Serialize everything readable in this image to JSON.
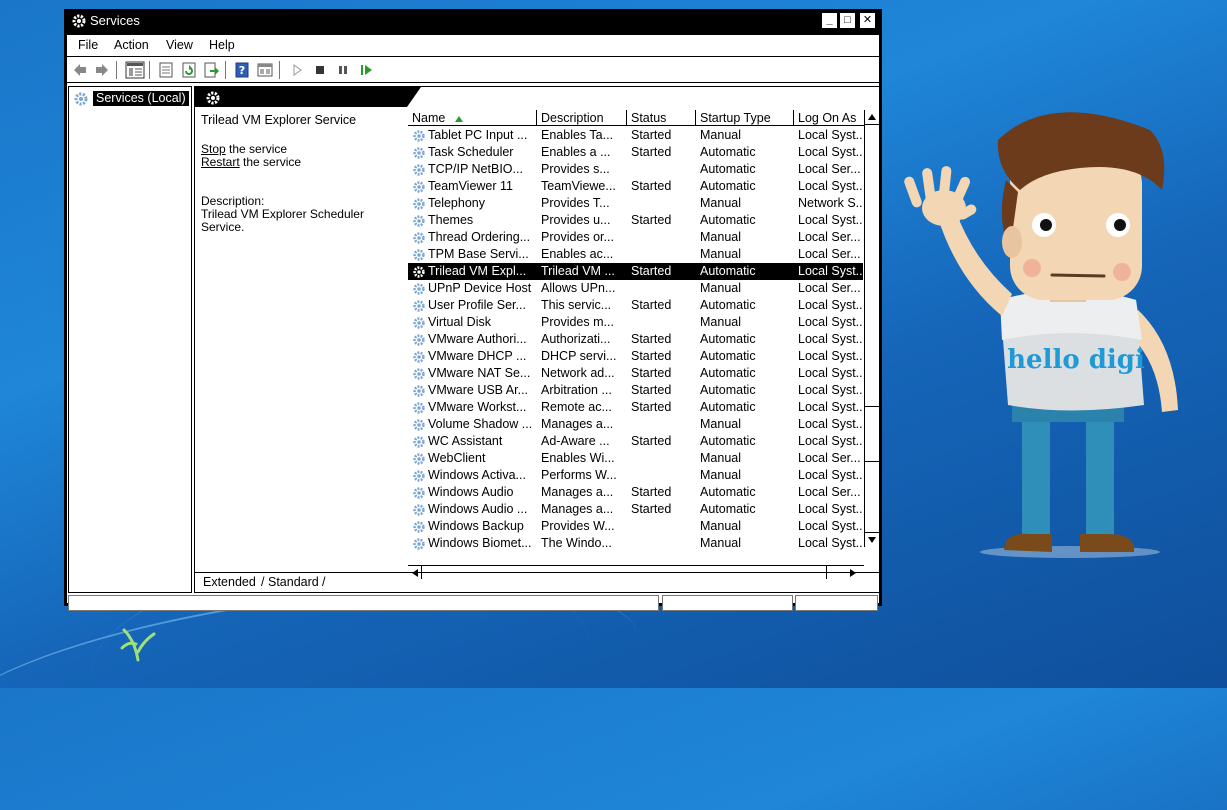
{
  "window": {
    "title": "Services"
  },
  "menu": [
    "File",
    "Action",
    "View",
    "Help"
  ],
  "tree": {
    "root_label": "Services (Local)"
  },
  "details": {
    "service_title": "Trilead VM Explorer Service",
    "stop_link": "Stop",
    "stop_rest": " the service",
    "restart_link": "Restart",
    "restart_rest": " the service",
    "description_label": "Description:",
    "description_text": "Trilead VM Explorer Scheduler Service."
  },
  "columns": [
    "Name",
    "Description",
    "Status",
    "Startup Type",
    "Log On As"
  ],
  "rows": [
    {
      "name": "Tablet PC Input ...",
      "description": "Enables Ta...",
      "status": "Started",
      "startup": "Manual",
      "logon": "Local Syst..."
    },
    {
      "name": "Task Scheduler",
      "description": "Enables a ...",
      "status": "Started",
      "startup": "Automatic",
      "logon": "Local Syst..."
    },
    {
      "name": "TCP/IP NetBIO...",
      "description": "Provides s...",
      "status": "",
      "startup": "Automatic",
      "logon": "Local Ser..."
    },
    {
      "name": "TeamViewer 11",
      "description": "TeamViewe...",
      "status": "Started",
      "startup": "Automatic",
      "logon": "Local Syst..."
    },
    {
      "name": "Telephony",
      "description": "Provides T...",
      "status": "",
      "startup": "Manual",
      "logon": "Network S..."
    },
    {
      "name": "Themes",
      "description": "Provides u...",
      "status": "Started",
      "startup": "Automatic",
      "logon": "Local Syst..."
    },
    {
      "name": "Thread Ordering...",
      "description": "Provides or...",
      "status": "",
      "startup": "Manual",
      "logon": "Local Ser..."
    },
    {
      "name": "TPM Base Servi...",
      "description": "Enables ac...",
      "status": "",
      "startup": "Manual",
      "logon": "Local Ser..."
    },
    {
      "name": "Trilead VM Expl...",
      "description": "Trilead VM ...",
      "status": "Started",
      "startup": "Automatic",
      "logon": "Local Syst...",
      "selected": true
    },
    {
      "name": "UPnP Device Host",
      "description": "Allows UPn...",
      "status": "",
      "startup": "Manual",
      "logon": "Local Ser..."
    },
    {
      "name": "User Profile Ser...",
      "description": "This servic...",
      "status": "Started",
      "startup": "Automatic",
      "logon": "Local Syst..."
    },
    {
      "name": "Virtual Disk",
      "description": "Provides m...",
      "status": "",
      "startup": "Manual",
      "logon": "Local Syst..."
    },
    {
      "name": "VMware Authori...",
      "description": "Authorizati...",
      "status": "Started",
      "startup": "Automatic",
      "logon": "Local Syst..."
    },
    {
      "name": "VMware DHCP ...",
      "description": "DHCP servi...",
      "status": "Started",
      "startup": "Automatic",
      "logon": "Local Syst..."
    },
    {
      "name": "VMware NAT Se...",
      "description": "Network ad...",
      "status": "Started",
      "startup": "Automatic",
      "logon": "Local Syst..."
    },
    {
      "name": "VMware USB Ar...",
      "description": "Arbitration ...",
      "status": "Started",
      "startup": "Automatic",
      "logon": "Local Syst..."
    },
    {
      "name": "VMware Workst...",
      "description": "Remote ac...",
      "status": "Started",
      "startup": "Automatic",
      "logon": "Local Syst..."
    },
    {
      "name": "Volume Shadow ...",
      "description": "Manages a...",
      "status": "",
      "startup": "Manual",
      "logon": "Local Syst..."
    },
    {
      "name": "WC Assistant",
      "description": "Ad-Aware ...",
      "status": "Started",
      "startup": "Automatic",
      "logon": "Local Syst..."
    },
    {
      "name": "WebClient",
      "description": "Enables Wi...",
      "status": "",
      "startup": "Manual",
      "logon": "Local Ser..."
    },
    {
      "name": "Windows Activa...",
      "description": "Performs W...",
      "status": "",
      "startup": "Manual",
      "logon": "Local Syst..."
    },
    {
      "name": "Windows Audio",
      "description": "Manages a...",
      "status": "Started",
      "startup": "Automatic",
      "logon": "Local Ser..."
    },
    {
      "name": "Windows Audio ...",
      "description": "Manages a...",
      "status": "Started",
      "startup": "Automatic",
      "logon": "Local Syst..."
    },
    {
      "name": "Windows Backup",
      "description": "Provides W...",
      "status": "",
      "startup": "Manual",
      "logon": "Local Syst..."
    },
    {
      "name": "Windows Biomet...",
      "description": "The Windo...",
      "status": "",
      "startup": "Manual",
      "logon": "Local Syst..."
    }
  ],
  "tabs": [
    "Extended",
    "Standard"
  ],
  "mascot": {
    "shirt_text": "hello digi"
  },
  "icons": [
    "services-gear-icon",
    "back-arrow-icon",
    "forward-arrow-icon",
    "console-tree-icon",
    "properties-icon",
    "refresh-icon",
    "export-icon",
    "help-icon",
    "show-hide-icon",
    "start-icon",
    "stop-icon",
    "pause-icon",
    "resume-icon"
  ]
}
